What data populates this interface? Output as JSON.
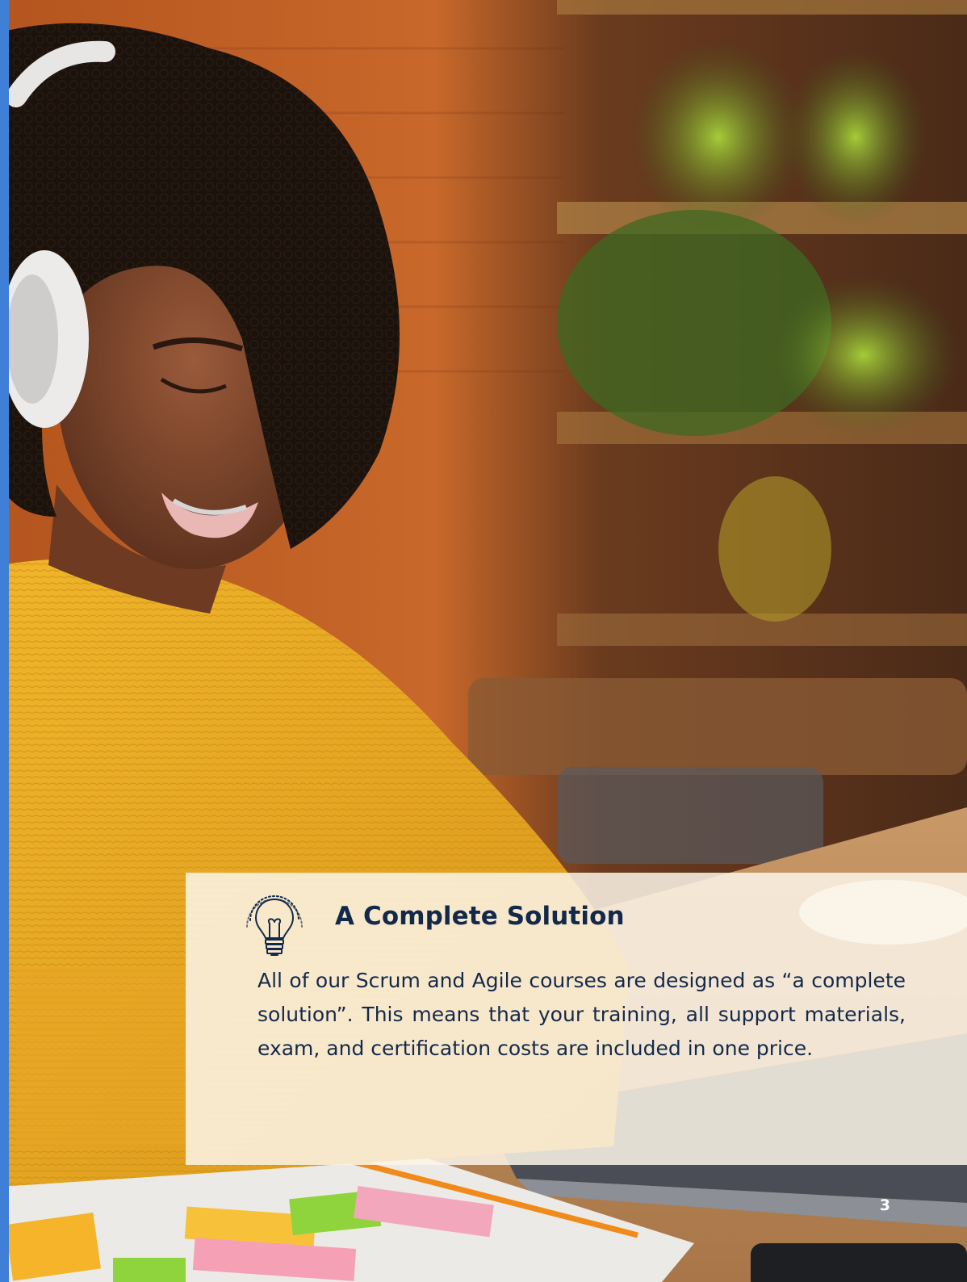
{
  "card": {
    "icon": "lightbulb-icon",
    "title": "A Complete Solution",
    "body": "All of our Scrum and Agile courses are designed as “a complete solution”. This means that your training, all support materials, exam, and certification costs are included in one price."
  },
  "page_number": "3",
  "colors": {
    "accent_stripe": "#3f7fd8",
    "title_text": "#13294b",
    "card_background": "#fcf4e8"
  }
}
